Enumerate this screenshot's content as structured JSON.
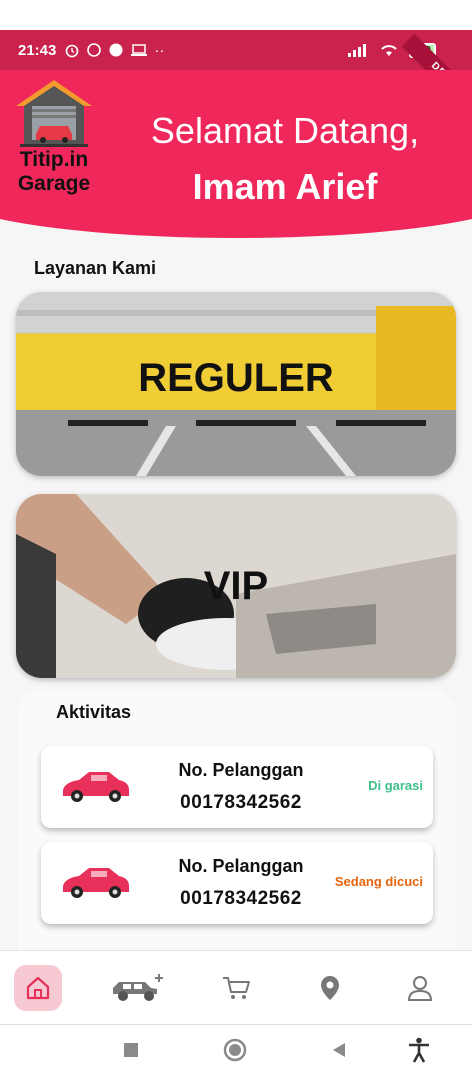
{
  "status_bar": {
    "time": "21:43",
    "battery": "100",
    "debug_label": "DEBUG"
  },
  "header": {
    "logo_line1": "Titip.in",
    "logo_line2": "Garage",
    "greeting": "Selamat Datang,",
    "user_name": "Imam Arief",
    "background_color": "#f0275a"
  },
  "services": {
    "section_title": "Layanan Kami",
    "items": [
      {
        "label": "REGULER"
      },
      {
        "label": "VIP"
      }
    ]
  },
  "activities": {
    "section_title": "Aktivitas",
    "items": [
      {
        "label": "No. Pelanggan",
        "number": "00178342562",
        "status": "Di garasi",
        "status_color": "#3fbf8a"
      },
      {
        "label": "No. Pelanggan",
        "number": "00178342562",
        "status": "Sedang dicuci",
        "status_color": "#e8640c"
      }
    ]
  },
  "bottom_nav": {
    "items": [
      {
        "icon": "home-icon",
        "active": true
      },
      {
        "icon": "car-add-icon",
        "active": false
      },
      {
        "icon": "cart-icon",
        "active": false
      },
      {
        "icon": "location-pin-icon",
        "active": false
      },
      {
        "icon": "profile-icon",
        "active": false
      }
    ]
  },
  "system_nav": {
    "items": [
      {
        "icon": "recents-icon"
      },
      {
        "icon": "home-circle-icon"
      },
      {
        "icon": "back-icon"
      },
      {
        "icon": "accessibility-icon"
      }
    ]
  }
}
